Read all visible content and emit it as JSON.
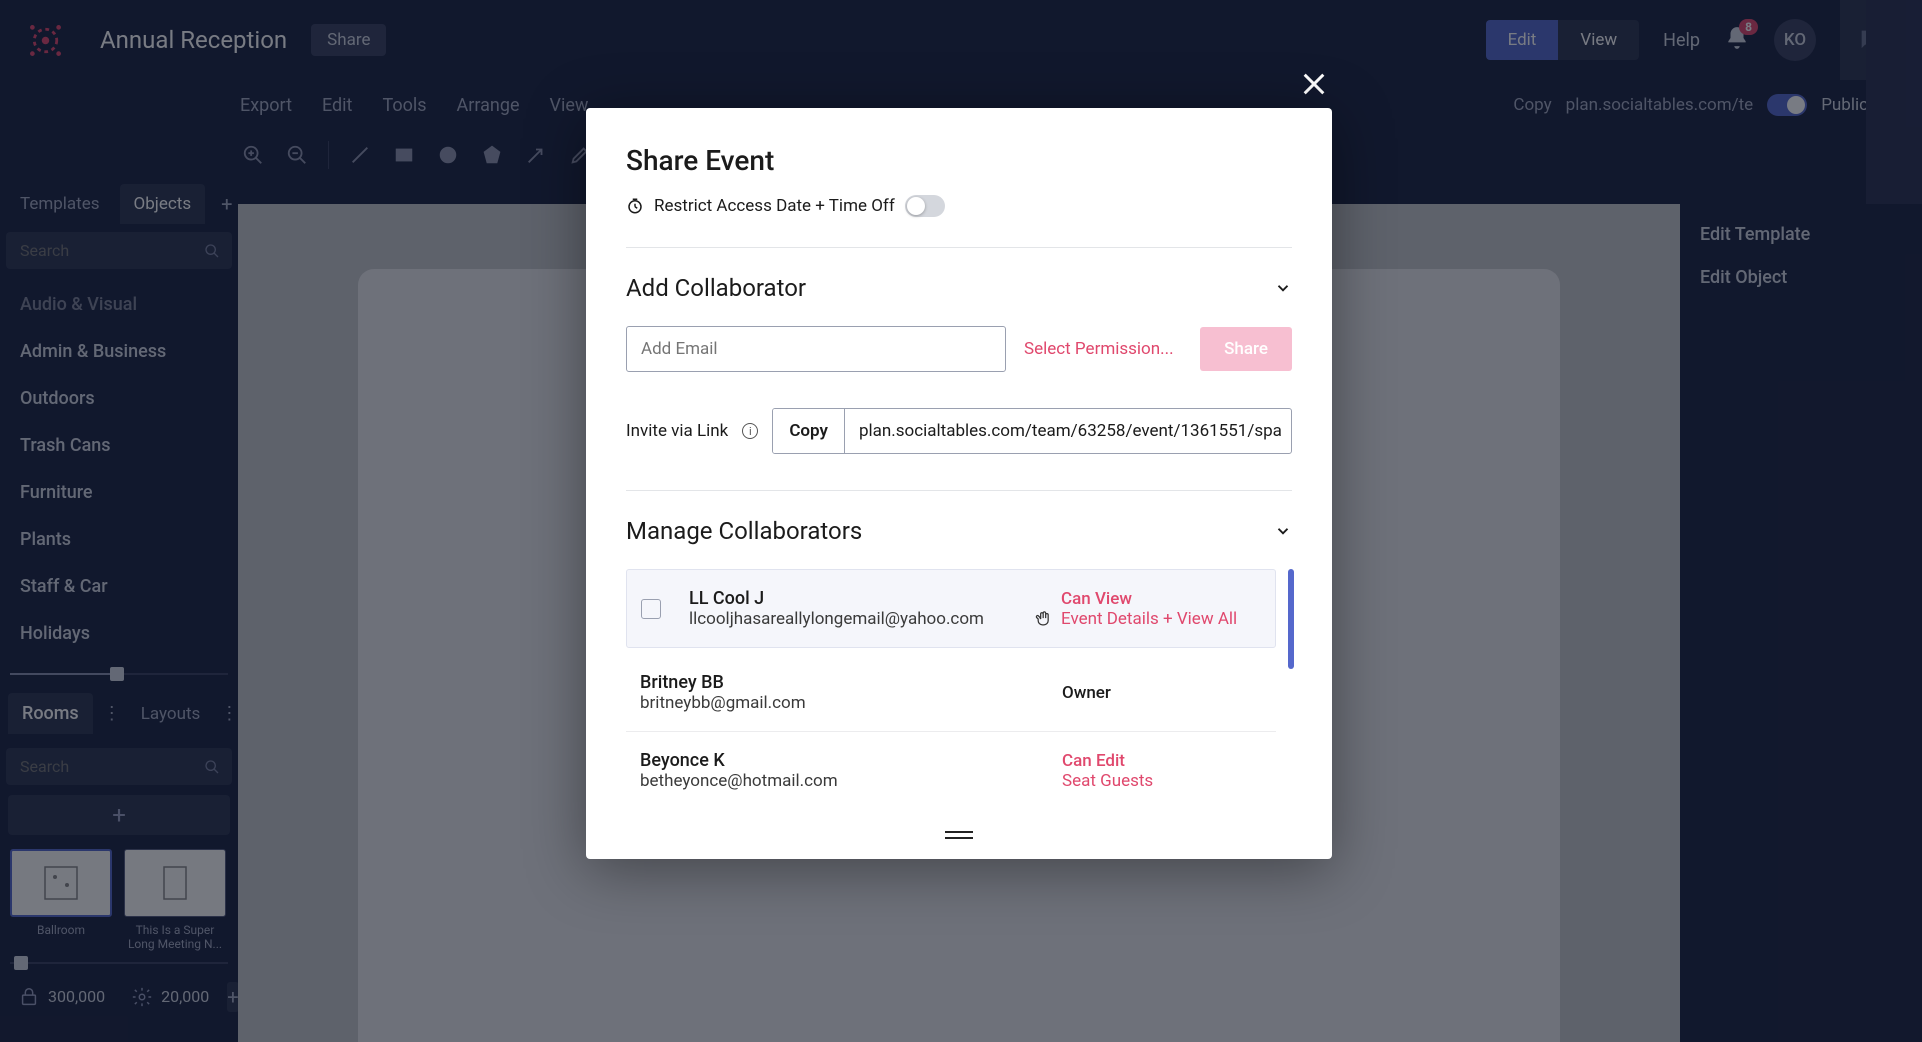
{
  "app": {
    "project_title": "Annual Reception",
    "share_label": "Share",
    "edit_label": "Edit",
    "view_label": "View",
    "help_label": "Help",
    "notifications_count": "8",
    "avatar_initials": "KO"
  },
  "menu": {
    "items": [
      "Export",
      "Edit",
      "Tools",
      "Arrange",
      "View"
    ],
    "copy_label": "Copy",
    "url_fragment": "plan.socialtables.com/te",
    "public_label": "Public"
  },
  "sidebar": {
    "tabs": {
      "templates": "Templates",
      "objects": "Objects"
    },
    "search_placeholder": "Search",
    "categories": [
      "Audio & Visual",
      "Admin & Business",
      "Outdoors",
      "Trash Cans",
      "Furniture",
      "Plants",
      "Staff & Car",
      "Holidays"
    ],
    "rooms_label": "Rooms",
    "layouts_label": "Layouts",
    "rooms_search_placeholder": "Search",
    "thumb1_label": "Ballroom",
    "thumb2_label": "This Is a Super Long Meeting N...",
    "stat1": "300,000",
    "stat2": "20,000"
  },
  "right_panel": {
    "edit_template": "Edit Template",
    "edit_object": "Edit Object"
  },
  "modal": {
    "title": "Share Event",
    "restrict_label": "Restrict Access Date + Time Off",
    "add_collab_title": "Add Collaborator",
    "email_placeholder": "Add Email",
    "perm_select": "Select Permission...",
    "share_btn": "Share",
    "invite_label": "Invite via Link",
    "copy_btn": "Copy",
    "invite_url": "plan.socialtables.com/team/63258/event/1361551/spa",
    "manage_title": "Manage Collaborators",
    "collaborators": [
      {
        "name": "LL Cool J",
        "email": "llcooljhasareallylongemail@yahoo.com",
        "role": "Can View",
        "sub": "Event Details + View All"
      },
      {
        "name": "Britney BB",
        "email": "britneybb@gmail.com",
        "role": "Owner",
        "sub": ""
      },
      {
        "name": "Beyonce K",
        "email": "betheyonce@hotmail.com",
        "role": "Can Edit",
        "sub": "Seat Guests"
      }
    ]
  }
}
